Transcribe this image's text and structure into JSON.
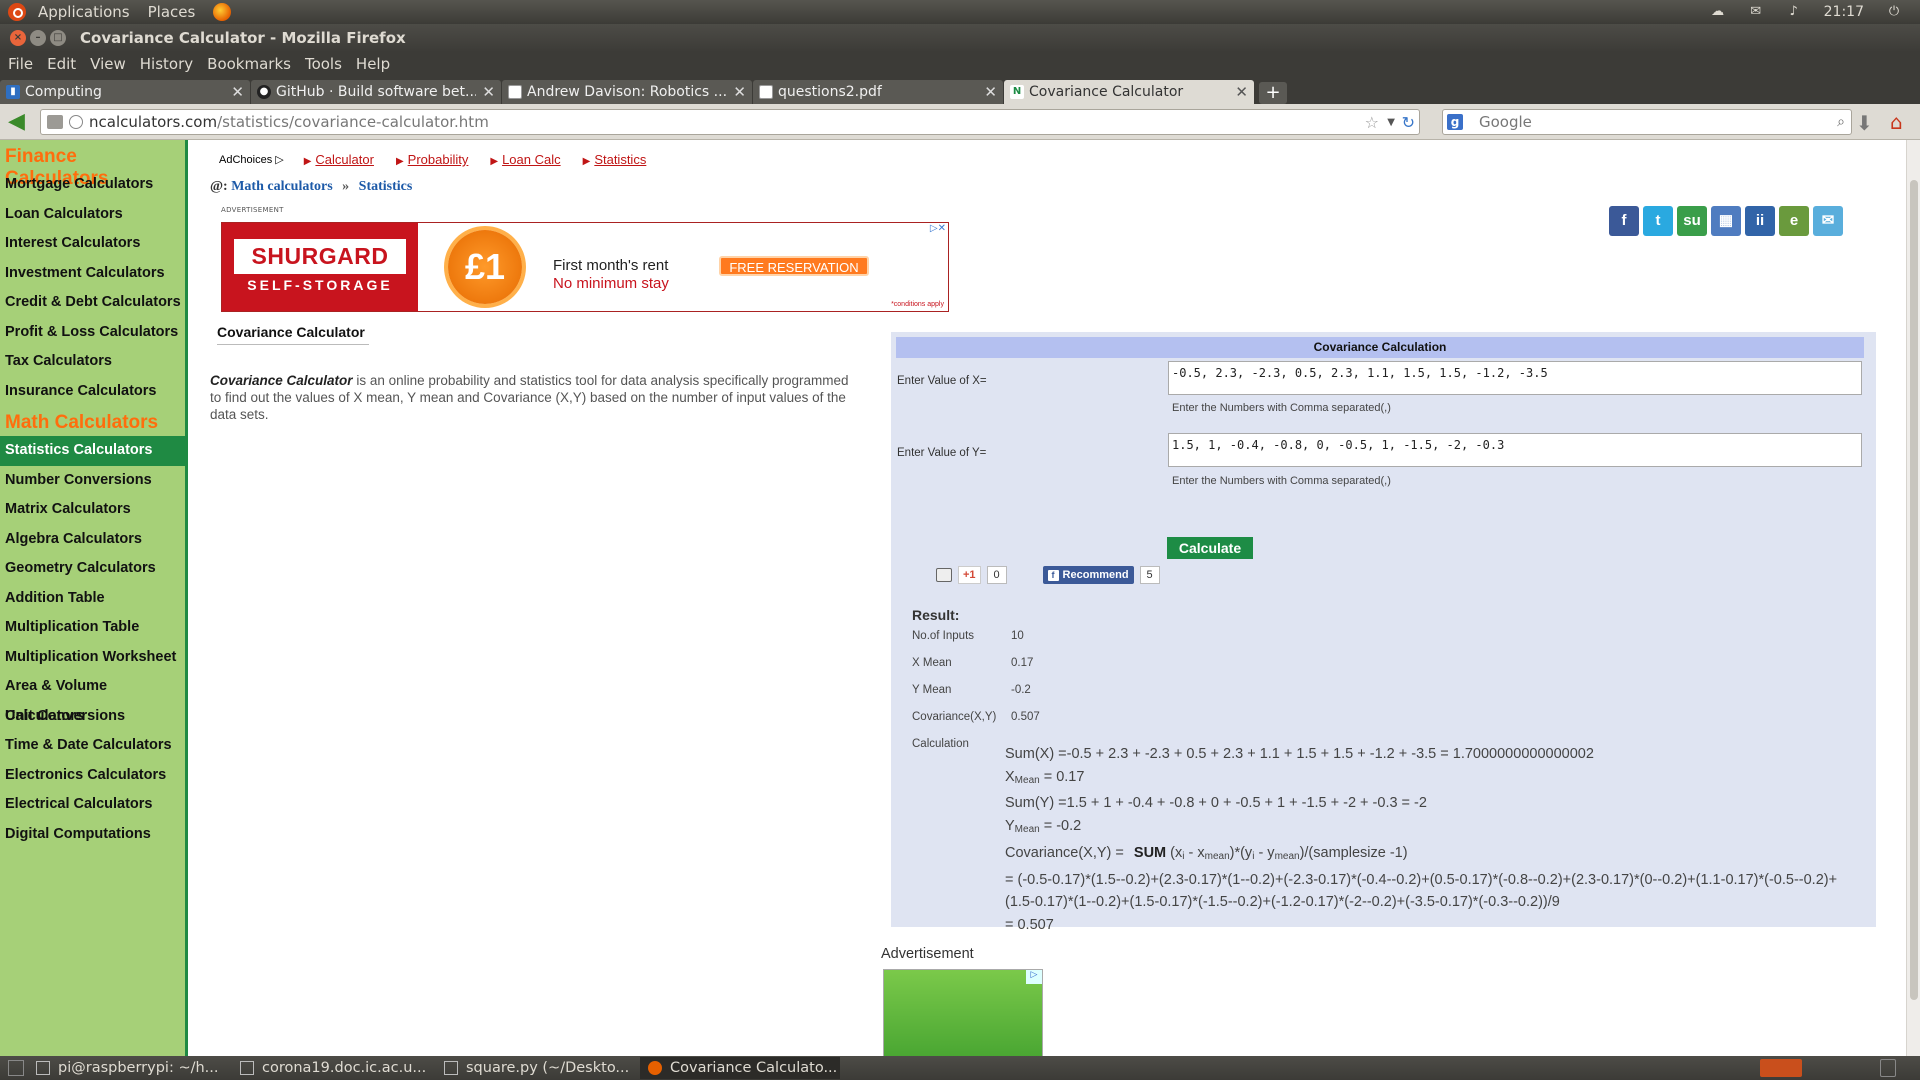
{
  "panel": {
    "applications": "Applications",
    "places": "Places",
    "clock": "21:17"
  },
  "window": {
    "title": "Covariance Calculator - Mozilla Firefox"
  },
  "menubar": [
    "File",
    "Edit",
    "View",
    "History",
    "Bookmarks",
    "Tools",
    "Help"
  ],
  "tabs": [
    {
      "title": "Computing",
      "fav": "chart-icon"
    },
    {
      "title": "GitHub · Build software bet...",
      "fav": "github-icon"
    },
    {
      "title": "Andrew Davison: Robotics ...",
      "fav": "page-icon"
    },
    {
      "title": "questions2.pdf",
      "fav": "page-icon"
    },
    {
      "title": "Covariance Calculator",
      "fav": "nc-icon",
      "active": true
    }
  ],
  "nav": {
    "url_domain": "ncalculators.com",
    "url_path": "/statistics/covariance-calculator.htm",
    "search_placeholder": "Google"
  },
  "sidebar": {
    "finance_head": "Finance Calculators",
    "finance_items": [
      "Mortgage Calculators",
      "Loan Calculators",
      "Interest Calculators",
      "Investment Calculators",
      "Credit & Debt Calculators",
      "Profit & Loss Calculators",
      "Tax Calculators",
      "Insurance Calculators"
    ],
    "math_head": "Math Calculators",
    "math_items": [
      "Statistics Calculators",
      "Number Conversions",
      "Matrix Calculators",
      "Algebra Calculators",
      "Geometry Calculators",
      "Addition Table",
      "Multiplication Table",
      "Multiplication Worksheet",
      "Area & Volume Calculators",
      "Unit Conversions",
      "Time & Date Calculators",
      "Electronics Calculators",
      "Electrical Calculators",
      "Digital Computations"
    ]
  },
  "adlinks": {
    "adchoices": "AdChoices",
    "links": [
      "Calculator",
      "Probability",
      "Loan Calc",
      "Statistics"
    ]
  },
  "breadcrumb": {
    "at": "@:",
    "math": "Math calculators",
    "sep": "»",
    "stats": "Statistics"
  },
  "ad_label": "ADVERTISEMENT",
  "banner": {
    "brand": "SHURGARD",
    "sub": "SELF-STORAGE",
    "price": "£1",
    "line1": "First month's rent",
    "line2": "No minimum stay",
    "cta": "FREE RESERVATION",
    "conditions": "*conditions apply"
  },
  "page_title": "Covariance Calculator",
  "description": {
    "lead": "Covariance Calculator",
    "text": " is an online probability and statistics tool for data analysis specifically programmed to find out the values of X mean, Y mean and Covariance (X,Y) based on the number of input values of the data sets."
  },
  "calc": {
    "heading": "Covariance Calculation",
    "x_label": "Enter Value of X=",
    "x_value": "-0.5, 2.3, -2.3, 0.5, 2.3, 1.1, 1.5, 1.5, -1.2, -3.5",
    "y_label": "Enter Value of Y=",
    "y_value": "1.5, 1, -0.4, -0.8, 0, -0.5, 1, -1.5, -2, -0.3",
    "hint": "Enter the Numbers with Comma separated(,)",
    "button": "Calculate",
    "gplus": "+1",
    "gplus_count": "0",
    "fb_label": "Recommend",
    "fb_count": "5"
  },
  "result": {
    "heading": "Result:",
    "rows": [
      {
        "label": "No.of Inputs",
        "value": "10"
      },
      {
        "label": "X Mean",
        "value": "0.17"
      },
      {
        "label": "Y Mean",
        "value": "-0.2"
      },
      {
        "label": "Covariance(X,Y)",
        "value": "0.507"
      }
    ],
    "calc_label": "Calculation",
    "sum_x": "Sum(X) =-0.5 + 2.3 + -2.3 + 0.5 + 2.3 + 1.1 + 1.5 + 1.5 + -1.2 + -3.5 = 1.7000000000000002",
    "x_mean_lhs": "X",
    "x_mean_sub": "Mean",
    "x_mean_rhs": " = 0.17",
    "sum_y": "Sum(Y) =1.5 + 1 + -0.4 + -0.8 + 0 + -0.5 + 1 + -1.5 + -2 + -0.3 = -2",
    "y_mean_lhs": "Y",
    "y_mean_sub": "Mean",
    "y_mean_rhs": " = -0.2",
    "cov_lhs": "Covariance(X,Y) = ",
    "cov_sum": "SUM",
    "cov_x": "(x",
    "cov_xi": "i",
    "cov_minus_x": " - x",
    "cov_xmean": "mean",
    "cov_mid": ")*(y",
    "cov_yi": "i",
    "cov_minus_y": " - y",
    "cov_ymean": "mean",
    "cov_tail": ")/(samplesize -1)",
    "expansion_1": "= (-0.5-0.17)*(1.5--0.2)+(2.3-0.17)*(1--0.2)+(-2.3-0.17)*(-0.4--0.2)+(0.5-0.17)*(-0.8--0.2)+(2.3-0.17)*(0--0.2)+(1.1-0.17)*(-0.5--0.2)+",
    "expansion_2": "(1.5-0.17)*(1--0.2)+(1.5-0.17)*(-1.5--0.2)+(-1.2-0.17)*(-2--0.2)+(-3.5-0.17)*(-0.3--0.2))/9",
    "final": "= 0.507"
  },
  "advertisement2": "Advertisement",
  "taskbar": [
    {
      "title": "pi@raspberrypi: ~/h..."
    },
    {
      "title": "corona19.doc.ic.ac.u..."
    },
    {
      "title": "square.py (~/Deskto..."
    },
    {
      "title": "Covariance Calculato...",
      "active": true
    }
  ]
}
